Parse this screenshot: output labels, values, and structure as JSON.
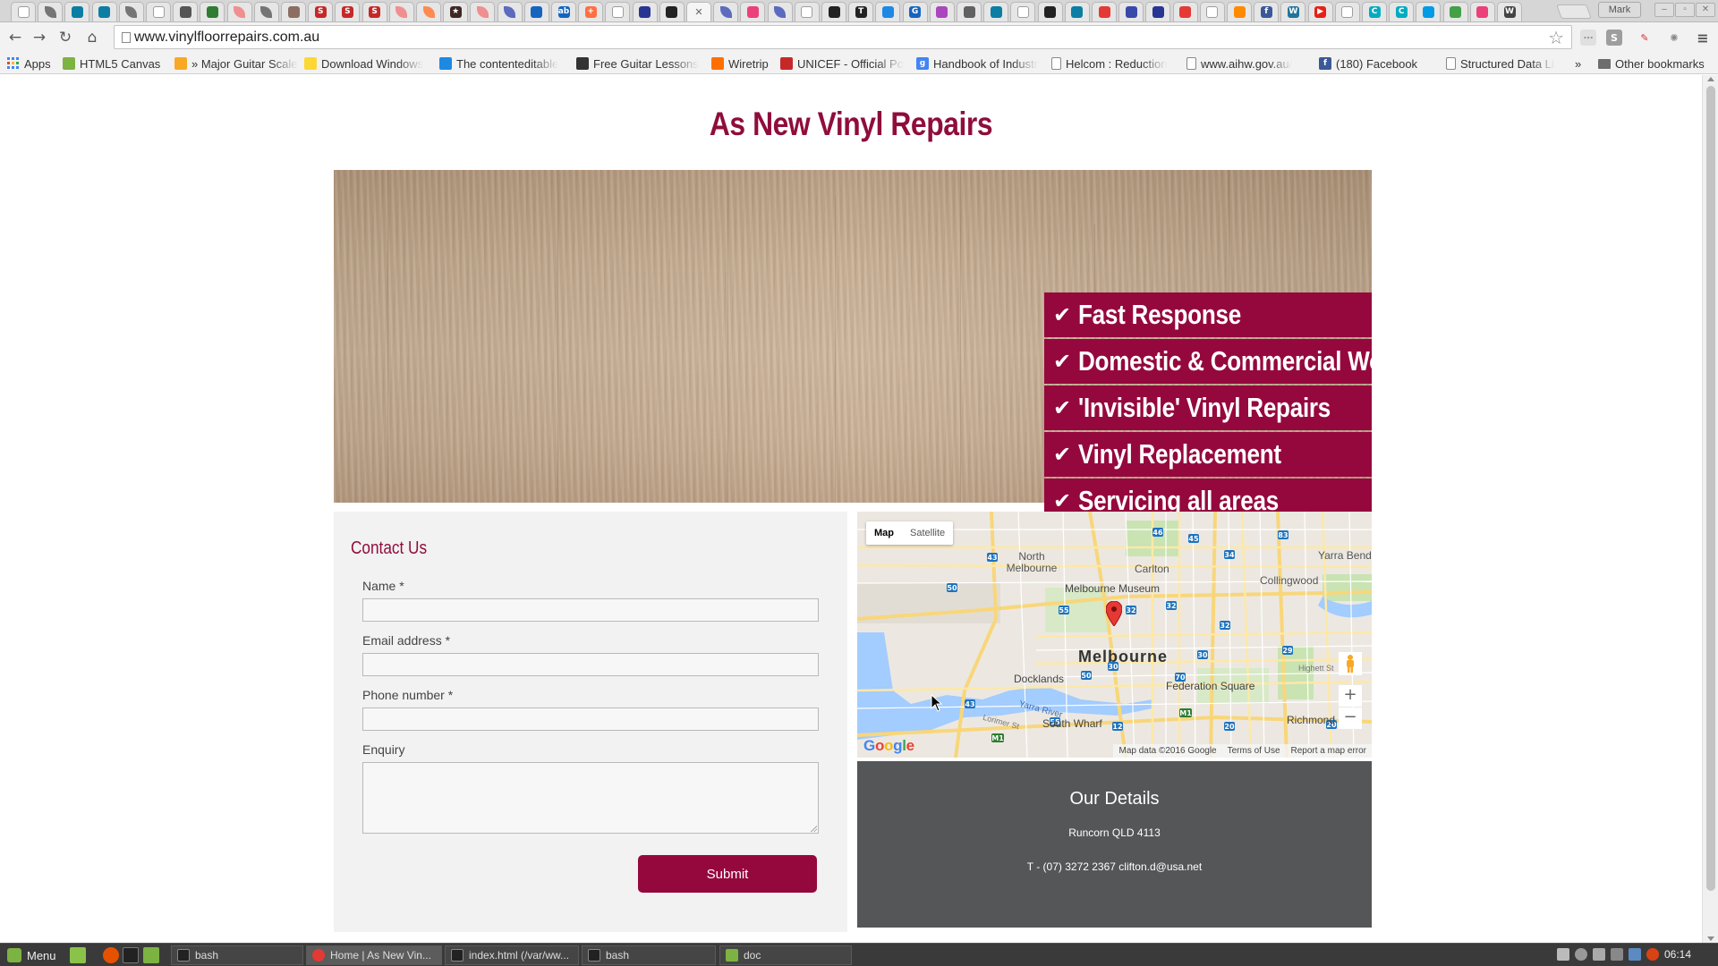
{
  "browser": {
    "tabs": [
      {
        "icon": "page-icon",
        "color": "#9e9e9e",
        "glyph": ""
      },
      {
        "icon": "feather-icon",
        "color": "#757575",
        "glyph": ""
      },
      {
        "icon": "codepen-icon",
        "color": "#0d7ea3",
        "glyph": ""
      },
      {
        "icon": "codepen-icon",
        "color": "#0d7ea3",
        "glyph": ""
      },
      {
        "icon": "feather-icon",
        "color": "#757575",
        "glyph": ""
      },
      {
        "icon": "page-icon",
        "color": "#9e9e9e",
        "glyph": ""
      },
      {
        "icon": "diamond-icon",
        "color": "#555555",
        "glyph": ""
      },
      {
        "icon": "code-icon",
        "color": "#2e7d32",
        "glyph": ""
      },
      {
        "icon": "feather-icon",
        "color": "#f08f8f",
        "glyph": ""
      },
      {
        "icon": "feather-icon",
        "color": "#757575",
        "glyph": ""
      },
      {
        "icon": "globe-icon",
        "color": "#8d6e63",
        "glyph": ""
      },
      {
        "icon": "s-red-icon",
        "color": "#c62828",
        "glyph": "S"
      },
      {
        "icon": "s-red-icon",
        "color": "#c62828",
        "glyph": "S"
      },
      {
        "icon": "s-red-icon",
        "color": "#c62828",
        "glyph": "S"
      },
      {
        "icon": "feather-icon",
        "color": "#f08f8f",
        "glyph": ""
      },
      {
        "icon": "feather-icon",
        "color": "#ff8a50",
        "glyph": ""
      },
      {
        "icon": "star-dark-icon",
        "color": "#3e2723",
        "glyph": "★"
      },
      {
        "icon": "feather-icon",
        "color": "#f08f8f",
        "glyph": ""
      },
      {
        "icon": "feather-icon",
        "color": "#5c6bc0",
        "glyph": ""
      },
      {
        "icon": "link-icon",
        "color": "#1565c0",
        "glyph": ""
      },
      {
        "icon": "ab-icon",
        "color": "#1565c0",
        "glyph": "ab"
      },
      {
        "icon": "plus-orange-icon",
        "color": "#ff7043",
        "glyph": "+"
      },
      {
        "icon": "box-icon",
        "color": "#9e9e9e",
        "glyph": ""
      },
      {
        "icon": "circle-dark-icon",
        "color": "#283593",
        "glyph": ""
      },
      {
        "icon": "github-icon",
        "color": "#222222",
        "glyph": ""
      },
      {
        "icon": "close-tab-icon",
        "color": "#f5f5f5",
        "glyph": "✕"
      },
      {
        "icon": "feather-icon",
        "color": "#5c6bc0",
        "glyph": ""
      },
      {
        "icon": "flower-icon",
        "color": "#ec407a",
        "glyph": ""
      },
      {
        "icon": "feather-icon",
        "color": "#5c6bc0",
        "glyph": ""
      },
      {
        "icon": "page-icon",
        "color": "#9e9e9e",
        "glyph": ""
      },
      {
        "icon": "download-icon",
        "color": "#222222",
        "glyph": ""
      },
      {
        "icon": "tm-icon",
        "color": "#222222",
        "glyph": "T"
      },
      {
        "icon": "square-blue-icon",
        "color": "#1e88e5",
        "glyph": ""
      },
      {
        "icon": "g-icon",
        "color": "#1565c0",
        "glyph": "G"
      },
      {
        "icon": "pinwheel-icon",
        "color": "#ab47bc",
        "glyph": ""
      },
      {
        "icon": "pdf-icon",
        "color": "#616161",
        "glyph": ""
      },
      {
        "icon": "codepen-icon",
        "color": "#0d7ea3",
        "glyph": ""
      },
      {
        "icon": "page-icon",
        "color": "#9e9e9e",
        "glyph": ""
      },
      {
        "icon": "github-icon",
        "color": "#222222",
        "glyph": ""
      },
      {
        "icon": "codepen-icon",
        "color": "#0d7ea3",
        "glyph": ""
      },
      {
        "icon": "house-red-icon",
        "color": "#e53935",
        "glyph": ""
      },
      {
        "icon": "circle-blue-icon",
        "color": "#3949ab",
        "glyph": ""
      },
      {
        "icon": "mail-icon",
        "color": "#283593",
        "glyph": ""
      },
      {
        "icon": "cloud-red-icon",
        "color": "#e53935",
        "glyph": ""
      },
      {
        "icon": "box-icon",
        "color": "#9e9e9e",
        "glyph": ""
      },
      {
        "icon": "rss-icon",
        "color": "#ff8a00",
        "glyph": ""
      },
      {
        "icon": "facebook-icon",
        "color": "#3b5998",
        "glyph": "f"
      },
      {
        "icon": "wordpress-icon",
        "color": "#21759b",
        "glyph": "W"
      },
      {
        "icon": "youtube-icon",
        "color": "#e62117",
        "glyph": "▶"
      },
      {
        "icon": "page-icon",
        "color": "#9e9e9e",
        "glyph": ""
      },
      {
        "icon": "c-teal-icon",
        "color": "#00acc1",
        "glyph": "C"
      },
      {
        "icon": "c-teal-icon",
        "color": "#00acc1",
        "glyph": "C"
      },
      {
        "icon": "plane-icon",
        "color": "#039be5",
        "glyph": ""
      },
      {
        "icon": "chrome-icon",
        "color": "#43a047",
        "glyph": ""
      },
      {
        "icon": "flower-icon",
        "color": "#ec407a",
        "glyph": ""
      },
      {
        "icon": "wikipedia-icon",
        "color": "#444444",
        "glyph": "W"
      }
    ],
    "profile_name": "Mark",
    "url": "www.vinylfloorrepairs.com.au",
    "bookmarks": [
      {
        "label": "Apps",
        "icon": "apps-grid-icon",
        "color": "#4285f4"
      },
      {
        "label": "HTML5 Canvas",
        "icon": "html5-icon",
        "color": "#7cb342"
      },
      {
        "label": "» Major Guitar Scales",
        "icon": "guitar-icon",
        "color": "#f9a825"
      },
      {
        "label": "Download Windows",
        "icon": "bulb-icon",
        "color": "#fdd835"
      },
      {
        "label": "The contenteditable",
        "icon": "circle-blue-icon",
        "color": "#1e88e5"
      },
      {
        "label": "Free Guitar Lessons",
        "icon": "guitar-icon",
        "color": "#333333"
      },
      {
        "label": "Wiretrip",
        "icon": "blogger-icon",
        "color": "#ff6f00"
      },
      {
        "label": "UNICEF - Official Po",
        "icon": "unicef-icon",
        "color": "#c62828"
      },
      {
        "label": "Handbook of Industr",
        "icon": "g-icon",
        "color": "#4285f4"
      },
      {
        "label": "Helcom : Reduction",
        "icon": "page-icon",
        "color": "#9e9e9e"
      },
      {
        "label": "www.aihw.gov.au/",
        "icon": "page-icon",
        "color": "#9e9e9e"
      },
      {
        "label": "(180) Facebook",
        "icon": "facebook-icon",
        "color": "#3b5998"
      },
      {
        "label": "Structured Data Lin",
        "icon": "page-icon",
        "color": "#9e9e9e"
      }
    ],
    "overflow_label": "»",
    "other_bookmarks": "Other bookmarks"
  },
  "site": {
    "title": "As New Vinyl Repairs",
    "features": [
      "Fast Response",
      "Domestic & Commercial Work",
      "'Invisible' Vinyl Repairs",
      "Vinyl Replacement",
      "Servicing all areas"
    ],
    "contact": {
      "title": "Contact Us",
      "fields": [
        {
          "label": "Name *",
          "value": ""
        },
        {
          "label": "Email address *",
          "value": ""
        },
        {
          "label": "Phone number *",
          "value": ""
        }
      ],
      "enquiry_label": "Enquiry",
      "submit_label": "Submit"
    },
    "map": {
      "type_map": "Map",
      "type_satellite": "Satellite",
      "labels": [
        "North Melbourne",
        "Carlton",
        "Collingwood",
        "Yarra Bend",
        "Melbourne Museum",
        "Melbourne",
        "Docklands",
        "Federation Square",
        "South Wharf",
        "Richmond",
        "Highett St",
        "Yarra River",
        "Lorimer St"
      ],
      "footer": [
        "Map data ©2016 Google",
        "Terms of Use",
        "Report a map error"
      ],
      "logo": "Google",
      "zoom_in": "+",
      "zoom_out": "−"
    },
    "details": {
      "title": "Our Details",
      "address": "Runcorn QLD 4113",
      "contact": "T - (07) 3272 2367 clifton.d@usa.net"
    },
    "colors": {
      "brand": "#95083d",
      "details_bg": "#555657"
    }
  },
  "taskbar": {
    "menu_label": "Menu",
    "tasks": [
      {
        "label": "bash",
        "icon": "terminal-icon"
      },
      {
        "label": "Home | As New Vin...",
        "icon": "chrome-icon"
      },
      {
        "label": "index.html (/var/ww...",
        "icon": "terminal-icon"
      },
      {
        "label": "bash",
        "icon": "terminal-icon"
      },
      {
        "label": "doc",
        "icon": "folder-icon"
      }
    ],
    "clock": "06:14"
  }
}
